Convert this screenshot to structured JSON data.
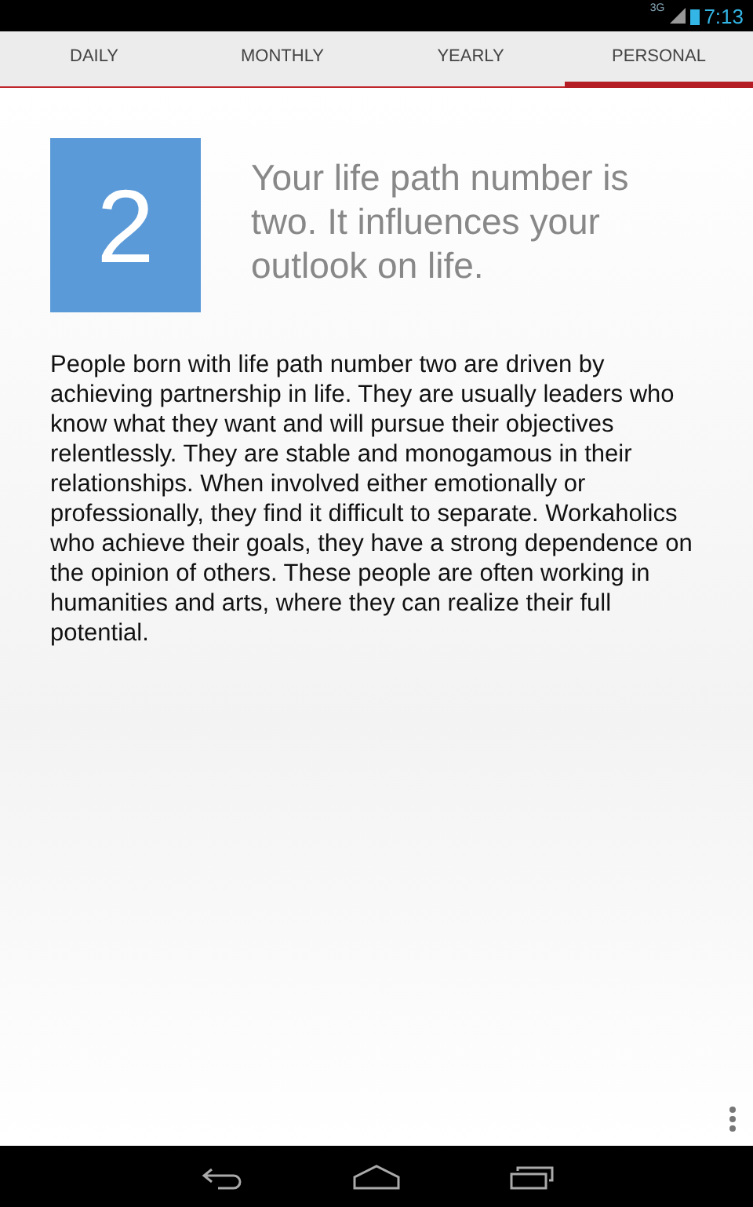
{
  "status_bar": {
    "network": "3G",
    "time": "7:13"
  },
  "tabs": [
    {
      "label": "DAILY",
      "selected": false
    },
    {
      "label": "MONTHLY",
      "selected": false
    },
    {
      "label": "YEARLY",
      "selected": false
    },
    {
      "label": "PERSONAL",
      "selected": true
    }
  ],
  "life_path": {
    "number": "2",
    "headline": "Your life path number is two.  It influences your outlook on life.",
    "description": "People born with life path number two are driven by achieving partnership in life. They are usually leaders who know what they want and will pursue their objectives relentlessly. They are stable and monogamous in their relationships. When involved either emotionally or professionally, they find it difficult to separate. Workaholics who achieve their goals, they have a strong dependence on the opinion of others. These people are often working in humanities and arts, where they can realize their full potential."
  }
}
